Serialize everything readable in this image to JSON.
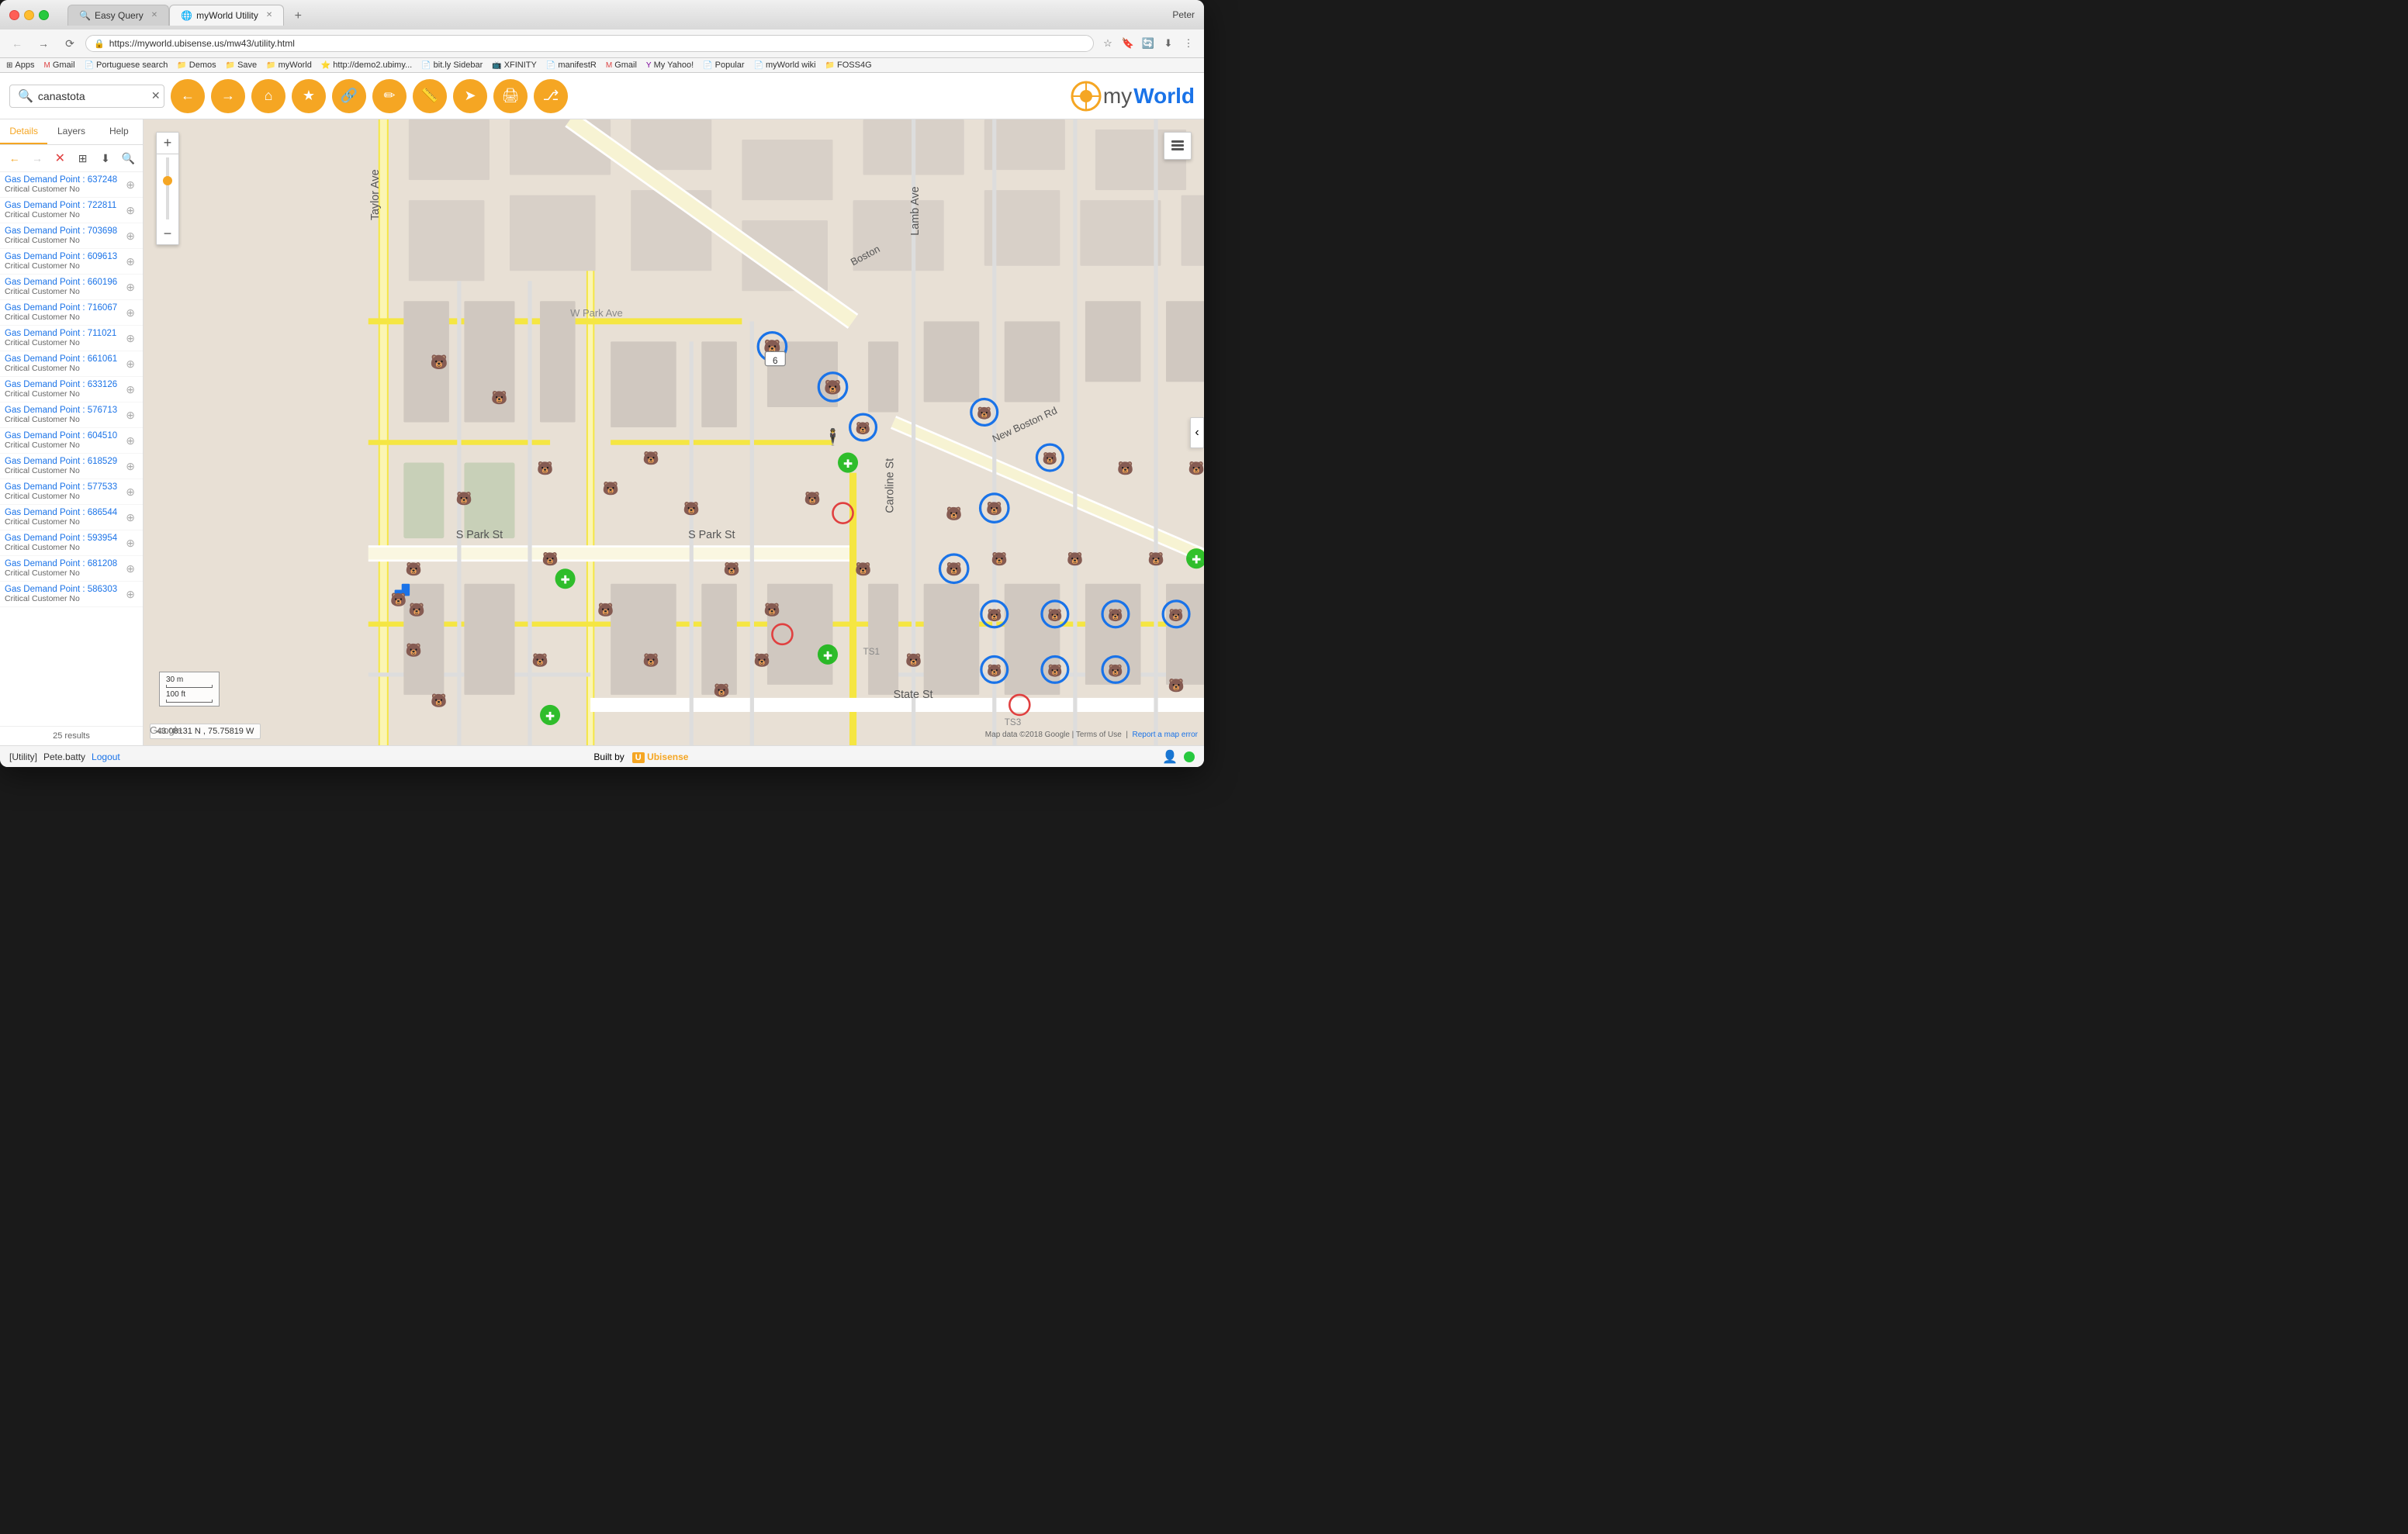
{
  "window": {
    "title": "myWorld Utility",
    "user": "Peter"
  },
  "tabs": [
    {
      "label": "Easy Query",
      "favicon": "🔍",
      "active": false
    },
    {
      "label": "myWorld Utility",
      "favicon": "🌐",
      "active": true
    }
  ],
  "browser": {
    "url": "https://myworld.ubisense.us/mw43/utility.html",
    "secure_label": "Secure"
  },
  "bookmarks": [
    {
      "icon": "⊞",
      "label": "Apps"
    },
    {
      "icon": "M",
      "label": "Gmail"
    },
    {
      "icon": "📄",
      "label": "Portuguese search"
    },
    {
      "icon": "📁",
      "label": "Demos"
    },
    {
      "icon": "📁",
      "label": "Save"
    },
    {
      "icon": "📁",
      "label": "myWorld"
    },
    {
      "icon": "⭐",
      "label": "http://demo2.ubimy..."
    },
    {
      "icon": "📄",
      "label": "bit.ly Sidebar"
    },
    {
      "icon": "📺",
      "label": "XFINITY"
    },
    {
      "icon": "📄",
      "label": "manifestR"
    },
    {
      "icon": "M",
      "label": "Gmail"
    },
    {
      "icon": "Y",
      "label": "My Yahoo!"
    },
    {
      "icon": "📄",
      "label": "Popular"
    },
    {
      "icon": "📄",
      "label": "myWorld wiki"
    },
    {
      "icon": "📁",
      "label": "FOSS4G"
    }
  ],
  "toolbar": {
    "search_placeholder": "canastota",
    "tools": [
      {
        "name": "back",
        "icon": "←"
      },
      {
        "name": "forward",
        "icon": "→"
      },
      {
        "name": "home",
        "icon": "⌂"
      },
      {
        "name": "bookmark",
        "icon": "★"
      },
      {
        "name": "link",
        "icon": "🔗"
      },
      {
        "name": "edit",
        "icon": "✏"
      },
      {
        "name": "measure",
        "icon": "📏"
      },
      {
        "name": "navigate",
        "icon": "➤"
      },
      {
        "name": "print",
        "icon": "🖨"
      },
      {
        "name": "share",
        "icon": "⎇"
      }
    ],
    "logo_my": "my",
    "logo_world": "World"
  },
  "sidebar": {
    "tabs": [
      "Details",
      "Layers",
      "Help"
    ],
    "active_tab": "Details",
    "results_count": "25 results",
    "items": [
      {
        "id": "637248",
        "title": "Gas Demand Point : 637248",
        "subtitle": "Critical Customer No"
      },
      {
        "id": "722811",
        "title": "Gas Demand Point : 722811",
        "subtitle": "Critical Customer No"
      },
      {
        "id": "703698",
        "title": "Gas Demand Point : 703698",
        "subtitle": "Critical Customer No"
      },
      {
        "id": "609613",
        "title": "Gas Demand Point : 609613",
        "subtitle": "Critical Customer No"
      },
      {
        "id": "660196",
        "title": "Gas Demand Point : 660196",
        "subtitle": "Critical Customer No"
      },
      {
        "id": "716067",
        "title": "Gas Demand Point : 716067",
        "subtitle": "Critical Customer No"
      },
      {
        "id": "711021",
        "title": "Gas Demand Point : 711021",
        "subtitle": "Critical Customer No"
      },
      {
        "id": "661061",
        "title": "Gas Demand Point : 661061",
        "subtitle": "Critical Customer No"
      },
      {
        "id": "633126",
        "title": "Gas Demand Point : 633126",
        "subtitle": "Critical Customer No"
      },
      {
        "id": "576713",
        "title": "Gas Demand Point : 576713",
        "subtitle": "Critical Customer No"
      },
      {
        "id": "604510",
        "title": "Gas Demand Point : 604510",
        "subtitle": "Critical Customer No"
      },
      {
        "id": "618529",
        "title": "Gas Demand Point : 618529",
        "subtitle": "Critical Customer No"
      },
      {
        "id": "577533",
        "title": "Gas Demand Point : 577533",
        "subtitle": "Critical Customer No"
      },
      {
        "id": "686544",
        "title": "Gas Demand Point : 686544",
        "subtitle": "Critical Customer No"
      },
      {
        "id": "593954",
        "title": "Gas Demand Point : 593954",
        "subtitle": "Critical Customer No"
      },
      {
        "id": "681208",
        "title": "Gas Demand Point : 681208",
        "subtitle": "Critical Customer No"
      },
      {
        "id": "586303",
        "title": "Gas Demand Point : 586303",
        "subtitle": "Critical Customer No"
      }
    ]
  },
  "map": {
    "zoom_in": "+",
    "zoom_out": "−",
    "coordinates": "43.08131 N , 75.75819 W",
    "scale_m": "30 m",
    "scale_ft": "100 ft",
    "attribution": "Map data ©2018 Google | Terms of Use",
    "report_error": "Report a map error"
  },
  "status": {
    "prefix": "[Utility]",
    "user": "Pete.batty",
    "logout": "Logout",
    "built_by": "Built by",
    "brand": "Ubisense"
  }
}
